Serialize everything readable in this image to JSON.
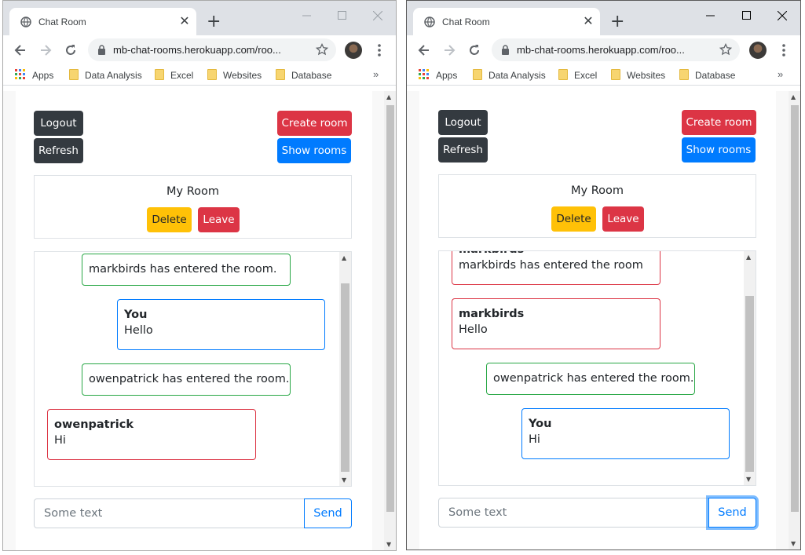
{
  "browser": {
    "tab_title": "Chat Room",
    "url": "mb-chat-rooms.herokuapp.com/roo...",
    "bookmarks": [
      "Apps",
      "Data Analysis",
      "Excel",
      "Websites",
      "Database"
    ]
  },
  "page": {
    "logout_label": "Logout",
    "refresh_label": "Refresh",
    "create_room_label": "Create room",
    "show_rooms_label": "Show rooms",
    "room_name": "My Room",
    "delete_label": "Delete",
    "leave_label": "Leave",
    "input_placeholder": "Some text",
    "send_label": "Send"
  },
  "left_chat": [
    {
      "kind": "system",
      "text": "markbirds has entered the room."
    },
    {
      "kind": "me",
      "user": "You",
      "text": "Hello"
    },
    {
      "kind": "system",
      "text": "owenpatrick has entered the room."
    },
    {
      "kind": "other",
      "user": "owenpatrick",
      "text": "Hi"
    }
  ],
  "right_chat": [
    {
      "kind": "other",
      "user": "markbirds",
      "text": "markbirds has entered the room"
    },
    {
      "kind": "other",
      "user": "markbirds",
      "text": "Hello"
    },
    {
      "kind": "system",
      "text": "owenpatrick has entered the room."
    },
    {
      "kind": "me",
      "user": "You",
      "text": "Hi"
    }
  ],
  "colors": {
    "dark": "#343a40",
    "danger": "#dc3545",
    "primary": "#007bff",
    "warning": "#ffc107",
    "success": "#28a745"
  }
}
